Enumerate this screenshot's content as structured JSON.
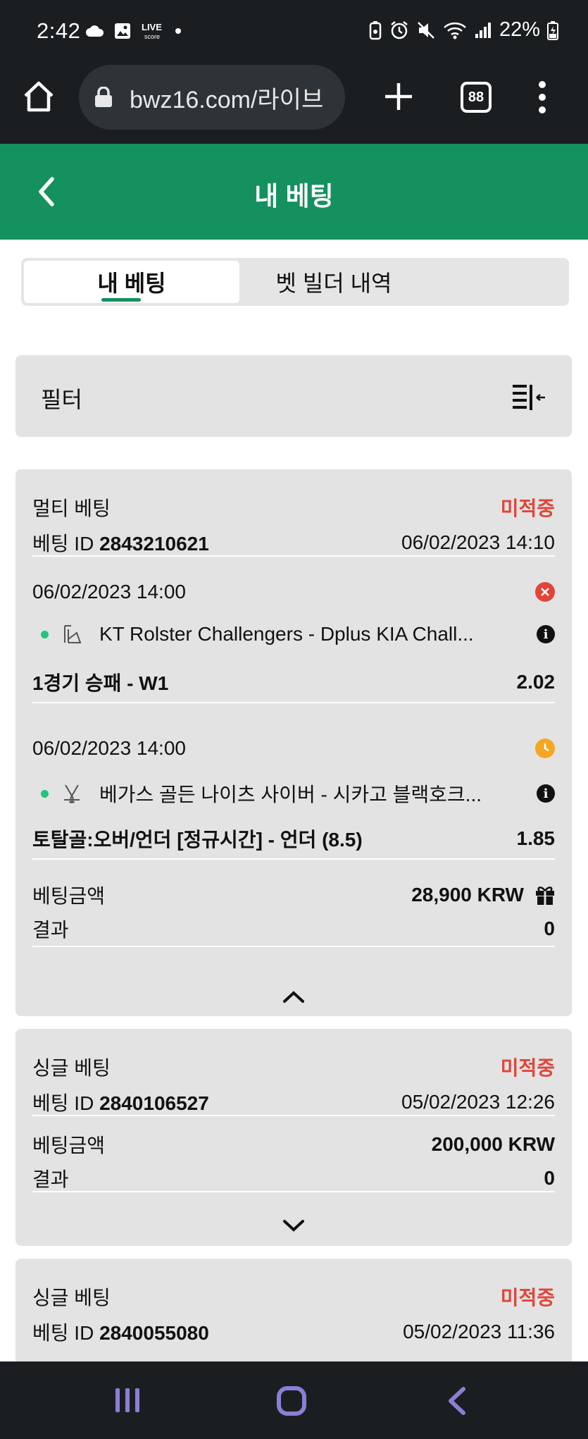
{
  "status_bar": {
    "time": "2:42",
    "battery": "22%"
  },
  "browser": {
    "url": "bwz16.com/라이브",
    "tab_count": "88"
  },
  "header": {
    "title": "내 베팅"
  },
  "segment": {
    "tabs": [
      "내 베팅",
      "벳 빌더 내역"
    ],
    "active": "내 베팅"
  },
  "filter": {
    "label": "필터"
  },
  "bets": [
    {
      "type": "멀티 베팅",
      "status": "미적중",
      "id_label": "베팅 ID",
      "id": "2843210621",
      "datetime": "06/02/2023 14:10",
      "selections": [
        {
          "datetime": "06/02/2023 14:00",
          "state_icon": "cross-circle-icon",
          "sport_icon": "esports-icon",
          "event": "KT Rolster Challengers - Dplus KIA Chall...",
          "market": "1경기 승패 - W1",
          "odds": "2.02"
        },
        {
          "datetime": "06/02/2023 14:00",
          "state_icon": "clock-icon",
          "sport_icon": "hockey-icon",
          "event": "베가스 골든 나이츠 사이버 - 시카고 블랙호크...",
          "market": "토탈골:오버/언더 [정규시간] - 언더 (8.5)",
          "odds": "1.85"
        }
      ],
      "stake_label": "베팅금액",
      "stake": "28,900 KRW",
      "result_label": "결과",
      "result": "0",
      "expanded": true
    },
    {
      "type": "싱글 베팅",
      "status": "미적중",
      "id_label": "베팅 ID",
      "id": "2840106527",
      "datetime": "05/02/2023 12:26",
      "stake_label": "베팅금액",
      "stake": "200,000 KRW",
      "result_label": "결과",
      "result": "0",
      "expanded": false
    },
    {
      "type": "싱글 베팅",
      "status": "미적중",
      "id_label": "베팅 ID",
      "id": "2840055080",
      "datetime": "05/02/2023 11:36"
    }
  ],
  "colors": {
    "brand_green": "#15915f",
    "status_red": "#e0453a",
    "pending_orange": "#f5a623",
    "card_bg": "#e3e3e3"
  }
}
